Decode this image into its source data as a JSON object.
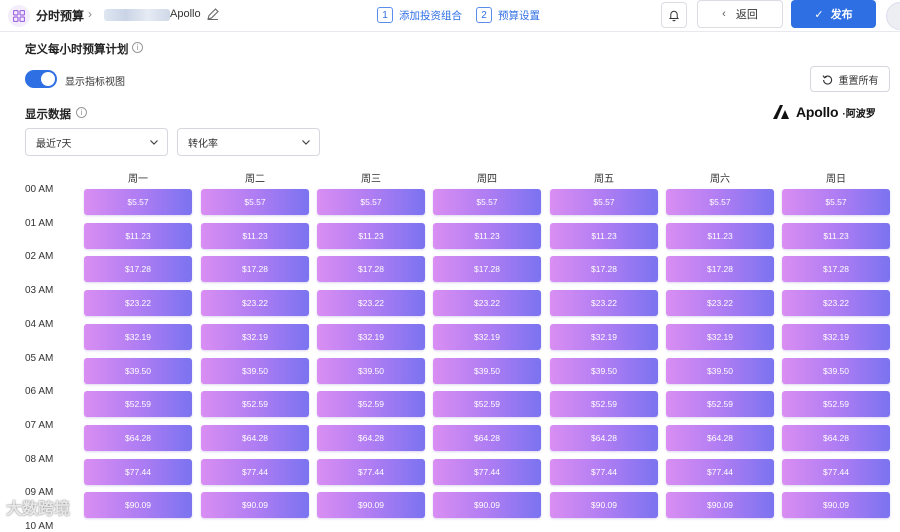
{
  "header": {
    "app_title": "分时预算",
    "campaign_name": "Apollo",
    "steps": [
      {
        "num": "1",
        "label": "添加投资组合"
      },
      {
        "num": "2",
        "label": "预算设置"
      }
    ],
    "back_label": "返回",
    "publish_label": "发布"
  },
  "plan": {
    "title": "定义每小时预算计划",
    "toggle_label": "显示指标视图",
    "toggle_on": true,
    "reset_label": "重置所有"
  },
  "display": {
    "title": "显示数据",
    "brand_word": "Apollo",
    "brand_cn": "阿波罗",
    "range_select": "最近7天",
    "metric_select": "转化率"
  },
  "grid": {
    "days": [
      "周一",
      "周二",
      "周三",
      "周四",
      "周五",
      "周六",
      "周日"
    ],
    "hours": [
      "00 AM",
      "01 AM",
      "02 AM",
      "03 AM",
      "04 AM",
      "05 AM",
      "06 AM",
      "07 AM",
      "08 AM",
      "09 AM",
      "10 AM"
    ],
    "values": [
      "$5.57",
      "$11.23",
      "$17.28",
      "$23.22",
      "$32.19",
      "$39.50",
      "$52.59",
      "$64.28",
      "$77.44",
      "$90.09"
    ]
  },
  "watermark": "大数跨境",
  "colors": {
    "accent": "#2f6fe4",
    "cell_start": "#d98ef2",
    "cell_end": "#7b73f0"
  }
}
